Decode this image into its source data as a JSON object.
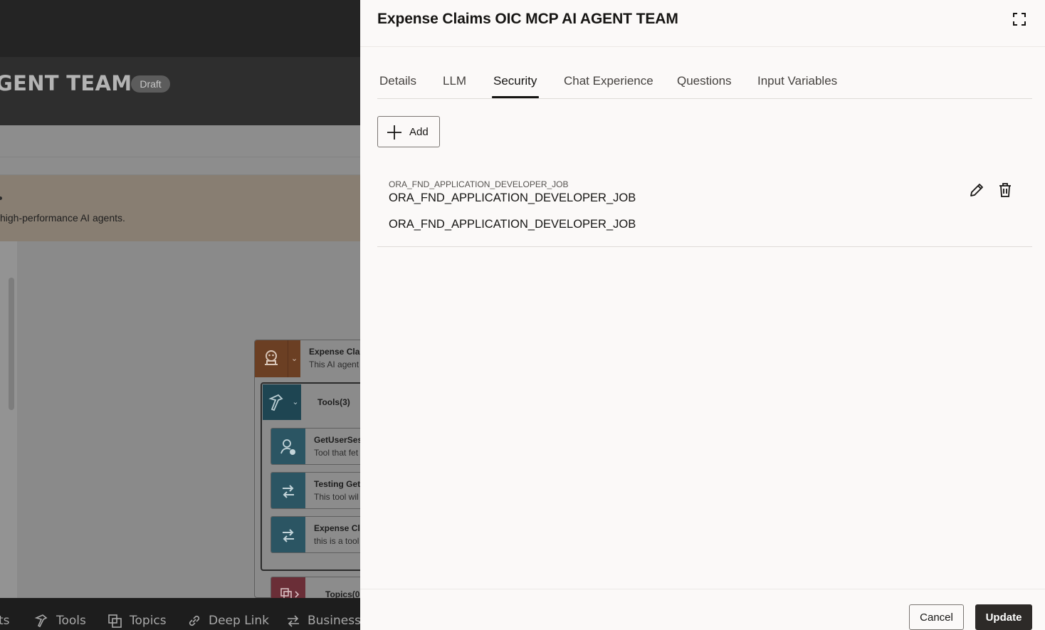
{
  "background": {
    "agent_title_fragment": "GENT TEAM",
    "status_badge": "Draft",
    "banner_text": "high-performance AI agents.",
    "agent_node": {
      "title": "Expense Clai",
      "subtitle": "This AI agent"
    },
    "tools_group": {
      "title": "Tools(3)"
    },
    "tool_nodes": [
      {
        "title": "GetUserSes",
        "subtitle": "Tool that fet",
        "icon": "user-clock-icon"
      },
      {
        "title": "Testing Get",
        "subtitle": "This tool wil",
        "icon": "api-arrows-icon"
      },
      {
        "title": "Expense Cl",
        "subtitle": "this is a tool",
        "icon": "api-arrows-icon"
      }
    ],
    "topics_node": {
      "title": "Topics(0"
    },
    "bottom_nav": [
      {
        "label": "ts",
        "icon": ""
      },
      {
        "label": "Tools",
        "icon": "hammer-icon"
      },
      {
        "label": "Topics",
        "icon": "stack-icon"
      },
      {
        "label": "Deep Link",
        "icon": "link-icon"
      },
      {
        "label": "Business (",
        "icon": "arrows-icon"
      }
    ]
  },
  "drawer": {
    "title": "Expense Claims OIC MCP AI AGENT TEAM",
    "tabs": [
      {
        "label": "Details",
        "active": false
      },
      {
        "label": "LLM",
        "active": false
      },
      {
        "label": "Security",
        "active": true
      },
      {
        "label": "Chat Experience",
        "active": false
      },
      {
        "label": "Questions",
        "active": false
      },
      {
        "label": "Input Variables",
        "active": false
      }
    ],
    "add_label": "Add",
    "roles": [
      {
        "label": "ORA_FND_APPLICATION_DEVELOPER_JOB",
        "name": "ORA_FND_APPLICATION_DEVELOPER_JOB",
        "code": "ORA_FND_APPLICATION_DEVELOPER_JOB"
      }
    ],
    "footer": {
      "cancel_label": "Cancel",
      "update_label": "Update"
    }
  },
  "colors": {
    "accent_dark": "#2d2a28",
    "drawer_bg": "#fbf9f8",
    "agent_orange": "#6b3f23",
    "tool_teal": "#2b5563",
    "topics_red": "#6a2e37"
  }
}
